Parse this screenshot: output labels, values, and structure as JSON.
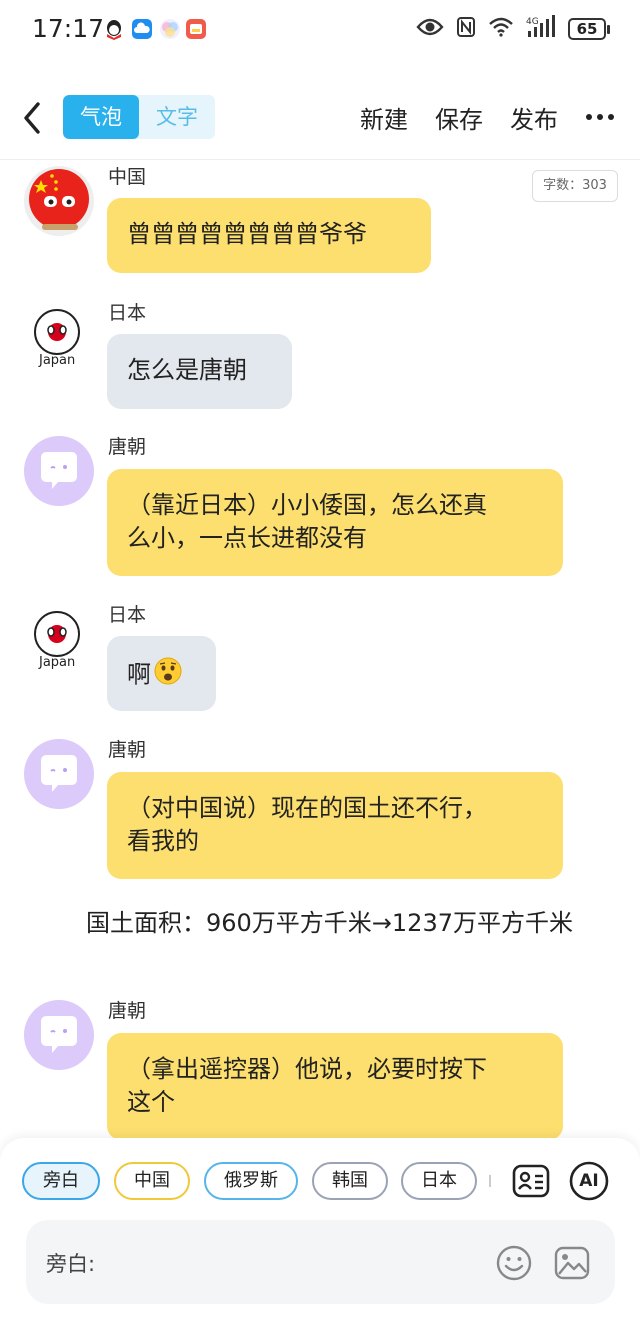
{
  "status_bar": {
    "time": "17:17",
    "battery": "65"
  },
  "top_bar": {
    "tabs": [
      {
        "label": "气泡",
        "active": true
      },
      {
        "label": "文字",
        "active": false
      }
    ],
    "actions": {
      "new": "新建",
      "save": "保存",
      "publish": "发布"
    }
  },
  "word_count": "字数：303",
  "messages": [
    {
      "speaker": "中国",
      "text": "曾曾曾曾曾曾曾曾爷爷",
      "avatar": "china-ball"
    },
    {
      "speaker": "日本",
      "text": "怎么是唐朝",
      "avatar": "japan-ball",
      "avatar_caption": "Japan"
    },
    {
      "speaker": "唐朝",
      "text_lines": [
        "（靠近日本）小小倭国，怎么还真",
        "么小，一点长进都没有"
      ],
      "avatar": "default-chat"
    },
    {
      "speaker": "日本",
      "text": "啊",
      "avatar": "japan-ball",
      "avatar_caption": "Japan",
      "emoji": "shocked-face"
    },
    {
      "speaker": "唐朝",
      "text_lines": [
        "（对中国说）现在的国土还不行，",
        "看我的"
      ],
      "avatar": "default-chat"
    },
    {
      "speaker": "唐朝",
      "text_lines": [
        "（拿出遥控器）他说，必要时按下",
        "这个"
      ],
      "avatar": "default-chat"
    }
  ],
  "narration": "国土面积：960万平方千米→1237万平方千米",
  "role_chips": [
    "旁白",
    "中国",
    "俄罗斯",
    "韩国",
    "日本"
  ],
  "role_chip_ai": "AI",
  "input": {
    "label": "旁白:",
    "value": ""
  },
  "colors": {
    "accent": "#29b1ee",
    "bubble_yellow": "#fcdf6e",
    "bubble_grey": "#e3e7ee",
    "default_avatar": "#dccafa"
  }
}
